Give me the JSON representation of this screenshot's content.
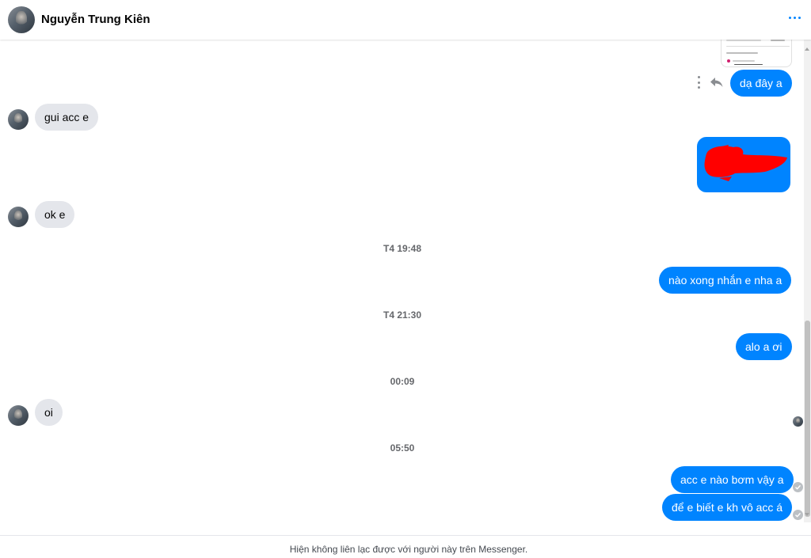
{
  "header": {
    "contact_name": "Nguyễn Trung Kiên",
    "more_icon": "more-dots-icon"
  },
  "messages": {
    "m1": "dạ đây a",
    "m2": "gui acc e",
    "m3": "ok e",
    "ts1": "T4 19:48",
    "m4": "nào xong nhắn e nha a",
    "ts2": "T4 21:30",
    "m5": "alo a ơi",
    "ts3": "00:09",
    "m6": "oi",
    "ts4": "05:50",
    "m7": "acc e nào bơm vậy a",
    "m8": "để e biết e kh vô acc á"
  },
  "footer": {
    "notice": "Hiện không liên lạc được với người này trên Messenger."
  },
  "colors": {
    "outgoing": "#0084ff",
    "incoming": "#e4e6eb",
    "redaction": "#ff0000"
  }
}
